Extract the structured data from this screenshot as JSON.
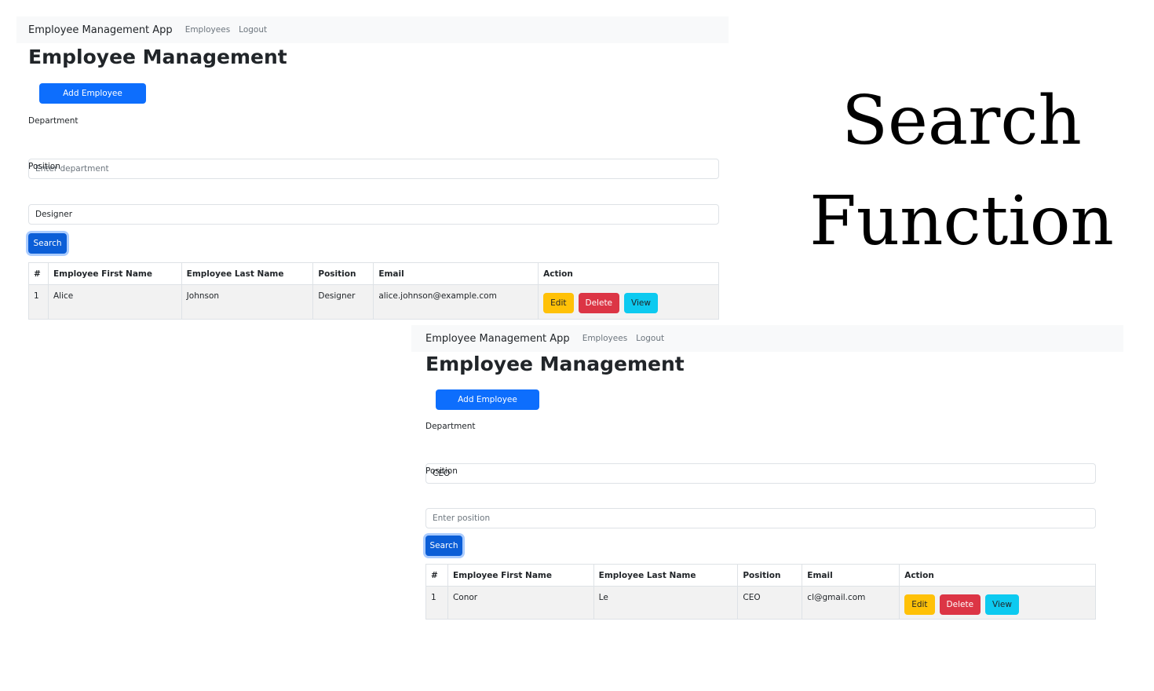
{
  "heading": {
    "line1": "Search",
    "line2": "Function"
  },
  "screens": [
    {
      "brand": "Employee Management App",
      "nav": [
        "Employees",
        "Logout"
      ],
      "title": "Employee Management",
      "add_button": "Add Employee",
      "department": {
        "label": "Department",
        "value": "",
        "placeholder": "Enter department"
      },
      "position": {
        "label": "Position",
        "value": "Designer",
        "placeholder": ""
      },
      "search_button": "Search",
      "table": {
        "headers": [
          "#",
          "Employee First Name",
          "Employee Last Name",
          "Position",
          "Email",
          "Action"
        ],
        "rows": [
          [
            "1",
            "Alice",
            "Johnson",
            "Designer",
            "alice.johnson@example.com"
          ]
        ]
      },
      "actions": [
        "Edit",
        "Delete",
        "View"
      ]
    },
    {
      "brand": "Employee Management App",
      "nav": [
        "Employees",
        "Logout"
      ],
      "title": "Employee Management",
      "add_button": "Add Employee",
      "department": {
        "label": "Department",
        "value": "CEO",
        "placeholder": ""
      },
      "position": {
        "label": "Position",
        "value": "",
        "placeholder": "Enter position"
      },
      "search_button": "Search",
      "table": {
        "headers": [
          "#",
          "Employee First Name",
          "Employee Last Name",
          "Position",
          "Email",
          "Action"
        ],
        "rows": [
          [
            "1",
            "Conor",
            "Le",
            "CEO",
            "cl@gmail.com"
          ]
        ]
      },
      "actions": [
        "Edit",
        "Delete",
        "View"
      ]
    }
  ],
  "colors": {
    "primary": "#0d6efd",
    "warning": "#ffc107",
    "danger": "#dc3545",
    "info": "#0dcaf0",
    "navbar": "#f8f9fa"
  }
}
